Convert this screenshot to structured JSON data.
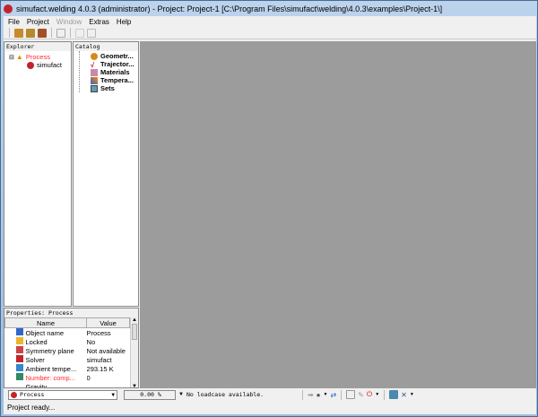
{
  "title": "simufact.welding 4.0.3 (administrator) - Project: Project-1 [C:\\Program Files\\simufact\\welding\\4.0.3\\examples\\Project-1\\]",
  "menu": [
    {
      "label": "File",
      "disabled": false
    },
    {
      "label": "Project",
      "disabled": false
    },
    {
      "label": "Window",
      "disabled": true
    },
    {
      "label": "Extras",
      "disabled": false
    },
    {
      "label": "Help",
      "disabled": false
    }
  ],
  "explorer": {
    "header": "Explorer",
    "items": [
      {
        "label": "Process",
        "color": "#ff2a2a",
        "icon": "warning-icon"
      },
      {
        "label": "simufact",
        "icon": "simufact-icon"
      }
    ]
  },
  "catalog": {
    "header": "Catalog",
    "items": [
      {
        "label": "Geometr...",
        "icon": "geometry-icon"
      },
      {
        "label": "Trajector...",
        "icon": "trajectory-icon"
      },
      {
        "label": "Materials",
        "icon": "materials-icon"
      },
      {
        "label": "Tempera...",
        "icon": "temperature-icon"
      },
      {
        "label": "Sets",
        "icon": "sets-icon"
      }
    ]
  },
  "properties": {
    "header": "Properties: Process",
    "columns": [
      "Name",
      "Value"
    ],
    "rows": [
      {
        "name": "Object name",
        "value": "Process",
        "icon": "pencil-icon"
      },
      {
        "name": "Locked",
        "value": "No",
        "icon": "lock-icon"
      },
      {
        "name": "Symmetry plane",
        "value": "Not available",
        "icon": "symmetry-icon"
      },
      {
        "name": "Solver",
        "value": "simufact",
        "icon": "simufact-icon"
      },
      {
        "name": "Ambient tempe...",
        "value": "293.15 K",
        "icon": "temperature-icon"
      },
      {
        "name": "Number: comp...",
        "value": "0",
        "icon": "cpu-icon",
        "color": "#ff2a2a"
      },
      {
        "name": "Gravity",
        "value": "",
        "icon": "expand-icon"
      }
    ]
  },
  "bottom": {
    "process_select": "Process",
    "progress": "0.00 %",
    "loadcase_message": "No loadcase available."
  },
  "status": "Project ready..."
}
